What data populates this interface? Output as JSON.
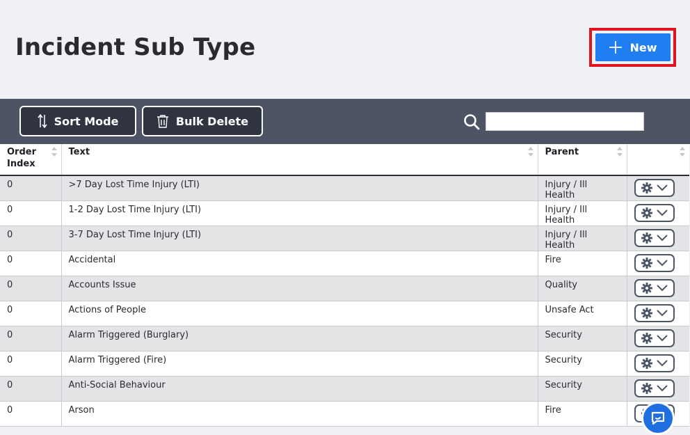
{
  "header": {
    "title": "Incident Sub Type",
    "new_label": "New"
  },
  "toolbar": {
    "sort_label": "Sort Mode",
    "bulk_label": "Bulk Delete",
    "search_value": ""
  },
  "table": {
    "columns": [
      "Order Index",
      "Text",
      "Parent",
      ""
    ],
    "rows": [
      {
        "order": "0",
        "text": ">7 Day Lost Time Injury (LTI)",
        "parent": "Injury / Ill Health"
      },
      {
        "order": "0",
        "text": "1-2 Day Lost Time Injury (LTI)",
        "parent": "Injury / Ill Health"
      },
      {
        "order": "0",
        "text": "3-7 Day Lost Time Injury (LTI)",
        "parent": "Injury / Ill Health"
      },
      {
        "order": "0",
        "text": "Accidental",
        "parent": "Fire"
      },
      {
        "order": "0",
        "text": "Accounts Issue",
        "parent": "Quality"
      },
      {
        "order": "0",
        "text": "Actions of People",
        "parent": "Unsafe Act"
      },
      {
        "order": "0",
        "text": "Alarm Triggered (Burglary)",
        "parent": "Security"
      },
      {
        "order": "0",
        "text": "Alarm Triggered (Fire)",
        "parent": "Security"
      },
      {
        "order": "0",
        "text": "Anti-Social Behaviour",
        "parent": "Security"
      },
      {
        "order": "0",
        "text": "Arson",
        "parent": "Fire"
      }
    ]
  },
  "colors": {
    "accent": "#1f7ff0",
    "highlight": "#e0141e",
    "toolbar": "#4d5463"
  },
  "icons": [
    "plus-icon",
    "sort-arrows-icon",
    "trash-icon",
    "search-icon",
    "gear-icon",
    "chevron-down-icon",
    "chat-icon"
  ]
}
